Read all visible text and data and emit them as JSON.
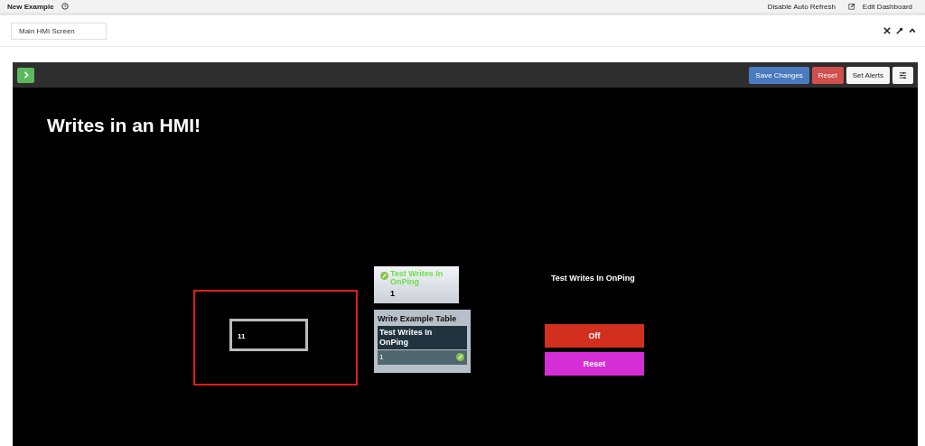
{
  "top_bar": {
    "title": "New Example",
    "links": [
      "Disable Auto Refresh",
      "Edit Dashboard"
    ]
  },
  "panel": {
    "screen_name": "Main HMI Screen"
  },
  "toolbar": {
    "buttons": [
      {
        "label": "Save Changes",
        "kind": "primary"
      },
      {
        "label": "Reset",
        "kind": "danger"
      },
      {
        "label": "Set Alerts",
        "kind": "default"
      }
    ]
  },
  "canvas": {
    "title": "Writes in an HMI!",
    "input_widget": {
      "value": "11",
      "selected": true
    },
    "status_card": {
      "label": "Test Writes In OnPing",
      "value": "1"
    },
    "table_card": {
      "title": "Write Example Table",
      "header": "Test Writes In OnPing",
      "value": "1"
    },
    "control_label": "Test Writes In OnPing",
    "control_buttons": [
      {
        "label": "Off",
        "color": "#d32f1f"
      },
      {
        "label": "Reset",
        "color": "#d62ed6"
      }
    ]
  }
}
